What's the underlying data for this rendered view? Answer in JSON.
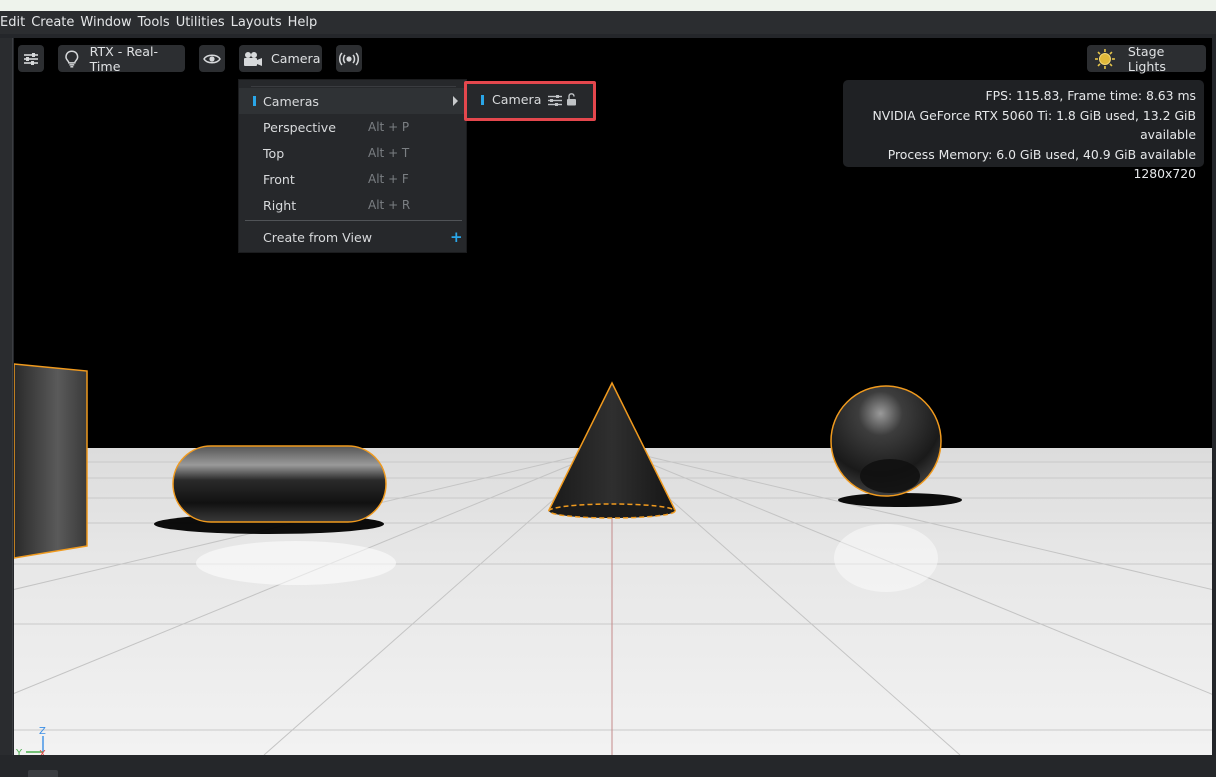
{
  "menubar": {
    "items": [
      "Edit",
      "Create",
      "Window",
      "Tools",
      "Utilities",
      "Layouts",
      "Help"
    ]
  },
  "toolbar": {
    "settings_icon": "sliders-icon",
    "render_mode_label": "RTX - Real-Time",
    "render_mode_icon": "lightbulb-icon",
    "view_icon": "eye-icon",
    "camera_label": "Camera",
    "camera_icon": "video-camera-icon",
    "broadcast_icon": "broadcast-icon",
    "stage_lights_label": "Stage Lights",
    "stage_lights_icon": "sun-icon"
  },
  "stats": {
    "fps_line": "FPS: 115.83, Frame time: 8.63 ms",
    "gpu_line": "NVIDIA GeForce RTX 5060 Ti: 1.8 GiB used, 13.2 GiB available",
    "memory_line": "Process Memory: 6.0 GiB used, 40.9 GiB available",
    "resolution": "1280x720"
  },
  "camera_menu": {
    "items": [
      {
        "label": "Cameras",
        "shortcut": ""
      },
      {
        "label": "Perspective",
        "shortcut": "Alt + P"
      },
      {
        "label": "Top",
        "shortcut": "Alt + T"
      },
      {
        "label": "Front",
        "shortcut": "Alt + F"
      },
      {
        "label": "Right",
        "shortcut": "Alt + R"
      },
      {
        "label": "Create from View",
        "shortcut": "+"
      }
    ],
    "submenu": {
      "camera_label": "Camera",
      "settings_icon": "sliders-icon",
      "lock_icon": "unlock-icon"
    }
  },
  "axis_gizmo": {
    "z_label": "Z",
    "y_label": "Y",
    "x_label": "X"
  },
  "colors": {
    "accent": "#2aa6e8",
    "highlight": "#e4474d",
    "selection_outline": "#f09a1e",
    "axis_x": "#e24a4a",
    "axis_y": "#4caf50",
    "axis_z": "#3a8ee6"
  }
}
